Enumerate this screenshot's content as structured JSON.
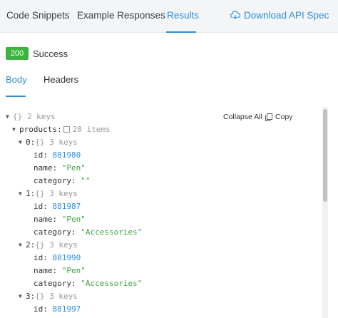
{
  "top_tabs": [
    {
      "label": "Code Snippets"
    },
    {
      "label": "Example Responses"
    },
    {
      "label": "Results"
    }
  ],
  "download_label": "Download API Spec",
  "status": {
    "code": "200",
    "text": "Success",
    "color": "#3fb33f"
  },
  "sub_tabs": [
    {
      "label": "Body"
    },
    {
      "label": "Headers"
    }
  ],
  "tree_actions": {
    "collapse": "Collapse All",
    "copy": "Copy"
  },
  "tree": {
    "root_meta": "{} 2 keys",
    "products_key": "products:",
    "products_meta": "20 items",
    "items": [
      {
        "index": "0:",
        "meta": "{} 3 keys",
        "id_key": "id:",
        "id": "881980",
        "name_key": "name:",
        "name": "\"Pen\"",
        "category_key": "category:",
        "category": "\"\""
      },
      {
        "index": "1:",
        "meta": "{} 3 keys",
        "id_key": "id:",
        "id": "881987",
        "name_key": "name:",
        "name": "\"Pen\"",
        "category_key": "category:",
        "category": "\"Accessories\""
      },
      {
        "index": "2:",
        "meta": "{} 3 keys",
        "id_key": "id:",
        "id": "881990",
        "name_key": "name:",
        "name": "\"Pen\"",
        "category_key": "category:",
        "category": "\"Accessories\""
      },
      {
        "index": "3:",
        "meta": "{} 3 keys",
        "id_key": "id:",
        "id": "881997"
      }
    ]
  },
  "colors": {
    "accent": "#2f8fdc",
    "success": "#3fb33f",
    "string": "#3fa33f",
    "number": "#2f8fdc"
  }
}
